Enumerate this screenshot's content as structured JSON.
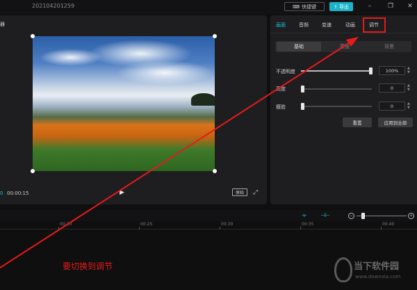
{
  "titlebar": {
    "project_title": "202104201259",
    "shortcut_label": "快捷键",
    "export_label": "导出"
  },
  "player": {
    "label": "器",
    "current_time": "0",
    "total_time": "00:00:15",
    "ratio_label": "原始"
  },
  "panel": {
    "tabs": [
      "画面",
      "音频",
      "变速",
      "动画",
      "调节"
    ],
    "active_tab": "画面",
    "highlighted_tab": "调节",
    "subtabs": [
      "基础",
      "蒙版",
      "背景"
    ],
    "params": [
      {
        "label": "不透明度",
        "value": "100%",
        "level": 1.0
      },
      {
        "label": "亮度",
        "value": "0",
        "level": 0.0
      },
      {
        "label": "瘦脸",
        "value": "0",
        "level": 0.0
      }
    ],
    "reset_label": "重置",
    "apply_all_label": "应用到全部"
  },
  "timeline": {
    "ticks": [
      "00:20",
      "00:25",
      "00:30",
      "00:35",
      "00:40"
    ]
  },
  "annotation": {
    "text": "要切换到调节",
    "color": "#e51b1b"
  },
  "watermark": {
    "title": "当下软件园",
    "url": "www.downxia.com"
  },
  "colors": {
    "accent": "#19c2d6",
    "highlight_box": "#e11b1b"
  }
}
